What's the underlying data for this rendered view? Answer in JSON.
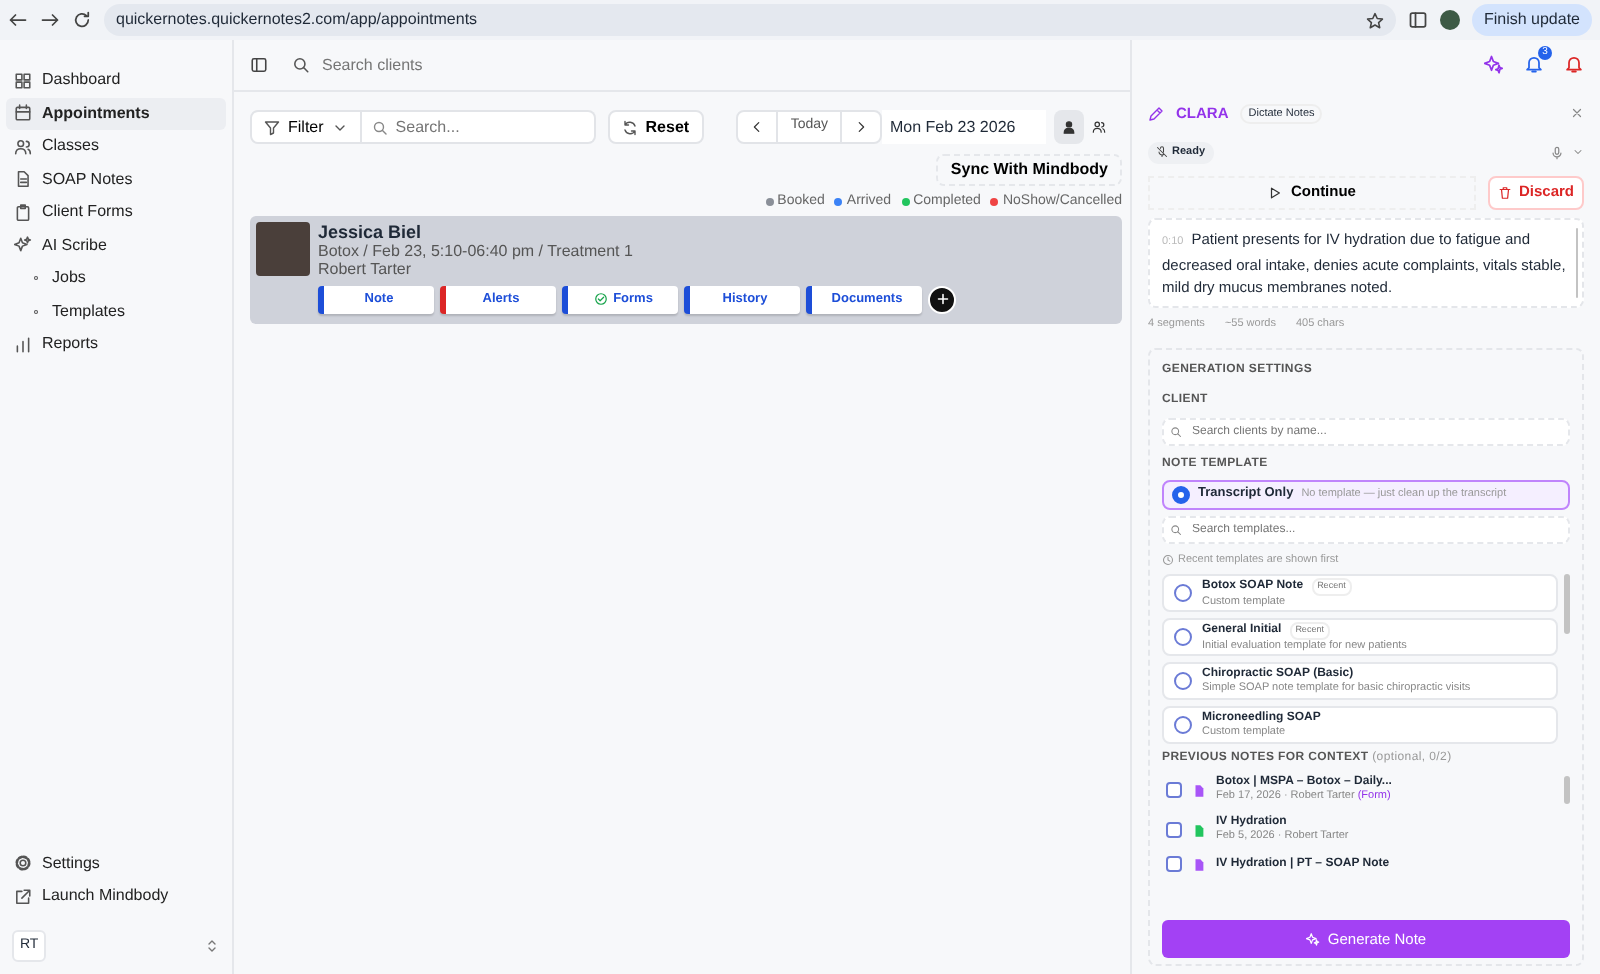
{
  "browser": {
    "url": "quickernotes.quickernotes2.com/app/appointments",
    "update_button": "Finish update"
  },
  "sidebar": {
    "items": [
      {
        "label": "Dashboard",
        "kind": "main",
        "selected": false
      },
      {
        "label": "Appointments",
        "kind": "main",
        "selected": true
      },
      {
        "label": "Classes",
        "kind": "main",
        "selected": false
      },
      {
        "label": "SOAP Notes",
        "kind": "main",
        "selected": false
      },
      {
        "label": "Client Forms",
        "kind": "main",
        "selected": false
      },
      {
        "label": "AI Scribe",
        "kind": "main",
        "selected": false
      },
      {
        "label": "Jobs",
        "kind": "sub",
        "selected": false
      },
      {
        "label": "Templates",
        "kind": "sub",
        "selected": false
      },
      {
        "label": "Reports",
        "kind": "main",
        "selected": false
      }
    ],
    "footer_items": [
      {
        "label": "Settings"
      },
      {
        "label": "Launch Mindbody"
      }
    ],
    "user": {
      "initials": "RT"
    }
  },
  "topbar": {
    "search_placeholder": "Search clients",
    "notification_count": "3"
  },
  "toolbar": {
    "filter": "Filter",
    "search_placeholder": "Search...",
    "reset": "Reset",
    "today": "Today",
    "date": "Mon Feb 23 2026",
    "sync": "Sync With Mindbody",
    "views": [
      {
        "kind": "single",
        "selected": true
      },
      {
        "kind": "group",
        "selected": false
      }
    ]
  },
  "legend": [
    {
      "label": "Booked",
      "color": "#8a8f98"
    },
    {
      "label": "Arrived",
      "color": "#3b82f6"
    },
    {
      "label": "Completed",
      "color": "#22c55e"
    },
    {
      "label": "NoShow/Cancelled",
      "color": "#ef4444"
    }
  ],
  "appointment": {
    "client": "Jessica Biel",
    "details": "Botox / Feb 23, 5:10-06:40 pm / Treatment 1",
    "provider": "Robert Tarter",
    "actions": [
      {
        "label": "Note",
        "kind": "plain",
        "color": "#1d4ed8"
      },
      {
        "label": "Alerts",
        "kind": "plain",
        "color": "#dc2626"
      },
      {
        "label": "Forms",
        "kind": "check",
        "color": "#1d4ed8"
      },
      {
        "label": "History",
        "kind": "plain",
        "color": "#1d4ed8"
      },
      {
        "label": "Documents",
        "kind": "plain",
        "color": "#1d4ed8"
      }
    ]
  },
  "clara": {
    "title": "CLARA",
    "mode_tab": "Dictate Notes",
    "status": "Ready",
    "continue": "Continue",
    "discard": "Discard",
    "transcript": [
      {
        "time": "0:10",
        "text": "Patient presents for IV hydration due to fatigue and decreased oral intake, denies acute complaints, vitals stable, mild dry mucus membranes noted."
      }
    ],
    "stats": [
      "4 segments",
      "~55 words",
      "405 chars"
    ],
    "settings": {
      "heading": "GENERATION SETTINGS",
      "client_label": "CLIENT",
      "client_placeholder": "Search clients by name...",
      "template_label": "NOTE TEMPLATE",
      "transcript_only": {
        "title": "Transcript Only",
        "description": "No template — just clean up the transcript",
        "selected": true
      },
      "template_search_placeholder": "Search templates...",
      "recent_hint": "Recent templates are shown first",
      "templates": [
        {
          "title": "Botox SOAP Note",
          "badge": "Recent",
          "description": "Custom template",
          "selected": false
        },
        {
          "title": "General Initial",
          "badge": "Recent",
          "description": "Initial evaluation template for new patients",
          "selected": false
        },
        {
          "title": "Chiropractic SOAP (Basic)",
          "description": "Simple SOAP note template for basic chiropractic visits",
          "selected": false
        },
        {
          "title": "Microneedling SOAP",
          "description": "Custom template",
          "selected": false
        }
      ],
      "previous_label": "PREVIOUS NOTES FOR CONTEXT",
      "previous_hint": "(optional, 0/2)",
      "previous_notes": [
        {
          "title": "Botox | MSPA – Botox – Daily...",
          "meta": "Feb 17, 2026 · Robert Tarter",
          "form": "(Form)",
          "color": "#a855f7",
          "checked": false
        },
        {
          "title": "IV Hydration",
          "meta": "Feb 5, 2026 · Robert Tarter",
          "color": "#22c55e",
          "checked": false
        },
        {
          "title": "IV Hydration | PT – SOAP Note",
          "color": "#a855f7",
          "checked": false
        }
      ]
    },
    "generate": "Generate Note"
  }
}
